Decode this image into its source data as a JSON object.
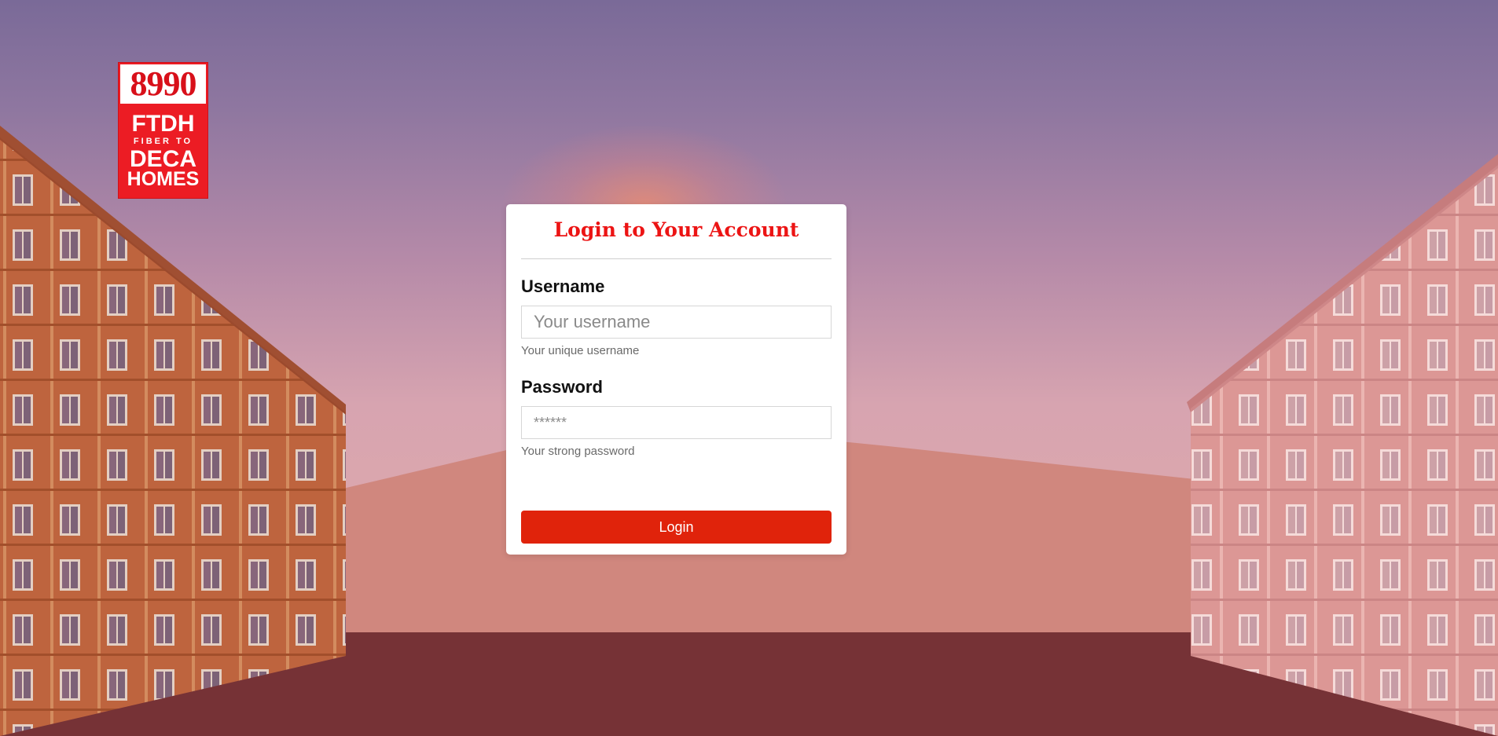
{
  "logo": {
    "number": "8990",
    "line1": "FTDH",
    "line2": "FIBER TO",
    "line3": "DECA",
    "line4": "HOMES"
  },
  "login": {
    "title": "Login to Your Account",
    "username": {
      "label": "Username",
      "placeholder": "Your username",
      "help": "Your unique username",
      "value": ""
    },
    "password": {
      "label": "Password",
      "placeholder": "******",
      "help": "Your strong password",
      "value": ""
    },
    "submit_label": "Login"
  },
  "colors": {
    "brand_red": "#ec1c24",
    "title_red": "#ec1414",
    "button_red": "#e0230b",
    "ground_dark": "#763236"
  }
}
